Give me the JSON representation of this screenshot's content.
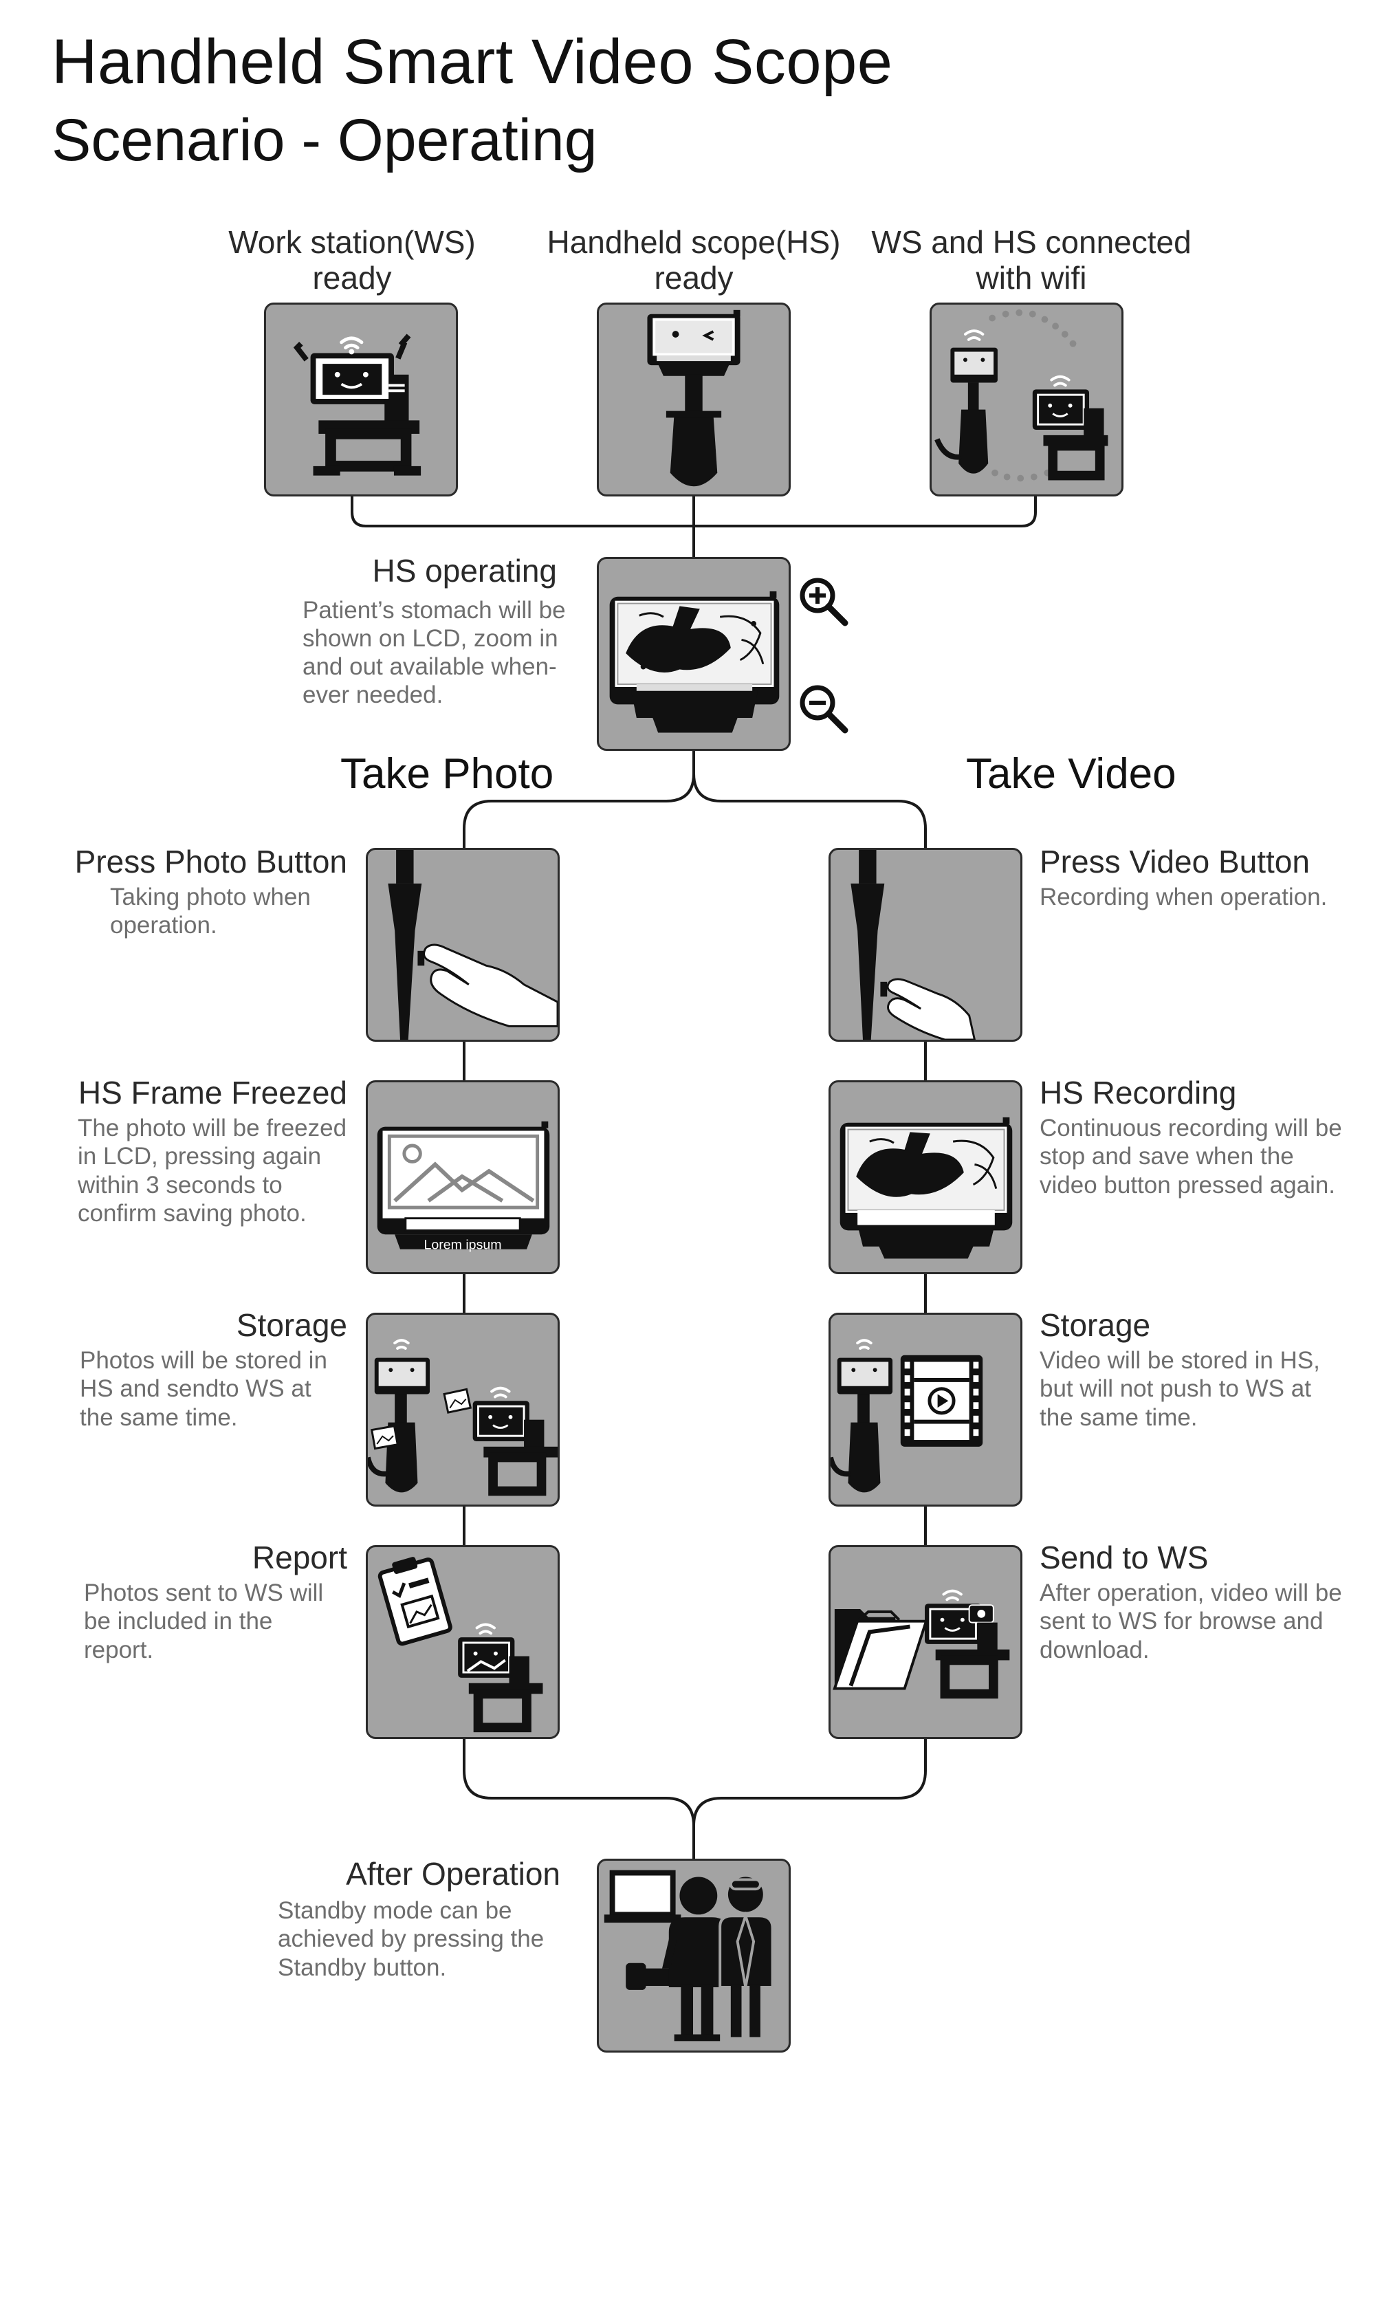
{
  "header": {
    "title": "Handheld Smart Video Scope",
    "subtitle": "Scenario - Operating"
  },
  "top_row": [
    {
      "title_line1": "Work station(WS)",
      "title_line2": "ready",
      "icon": "workstation-robot-icon"
    },
    {
      "title_line1": "Handheld scope(HS)",
      "title_line2": "ready",
      "icon": "handheld-scope-icon"
    },
    {
      "title_line1": "WS and HS connected",
      "title_line2": "with wifi",
      "icon": "wifi-connection-icon"
    }
  ],
  "operating": {
    "title": "HS operating",
    "description": "Patient’s stomach will be shown on LCD, zoom in and out available when-ever needed.",
    "icons": [
      "zoom-in-icon",
      "zoom-out-icon"
    ]
  },
  "branches": {
    "photo_label": "Take Photo",
    "video_label": "Take Video"
  },
  "photo_steps": [
    {
      "title": "Press Photo Button",
      "description": "Taking photo when operation."
    },
    {
      "title": "HS Frame Freezed",
      "description": "The photo will be freezed in LCD, pressing again within 3 seconds to confirm saving photo.",
      "screen_caption": "Lorem ipsum"
    },
    {
      "title": "Storage",
      "description": "Photos will be stored in HS and sendto WS at the same time."
    },
    {
      "title": "Report",
      "description": "Photos sent to WS will be included in the report."
    }
  ],
  "video_steps": [
    {
      "title": "Press Video Button",
      "description": "Recording when operation."
    },
    {
      "title": "HS Recording",
      "description": "Continuous recording will be stop and save when the video button pressed again."
    },
    {
      "title": "Storage",
      "description": "Video will be stored in HS, but will not push to WS at the same time."
    },
    {
      "title": "Send to WS",
      "description": "After operation, video will be sent to WS for browse and download."
    }
  ],
  "after": {
    "title": "After Operation",
    "description": "Standby mode can be achieved by pressing the Standby button."
  },
  "colors": {
    "panel_bg": "#a3a3a3",
    "panel_border": "#2b2b2b",
    "icon_fill": "#111111",
    "connector": "#1a1a1a",
    "description_text": "#6e6e6e"
  }
}
